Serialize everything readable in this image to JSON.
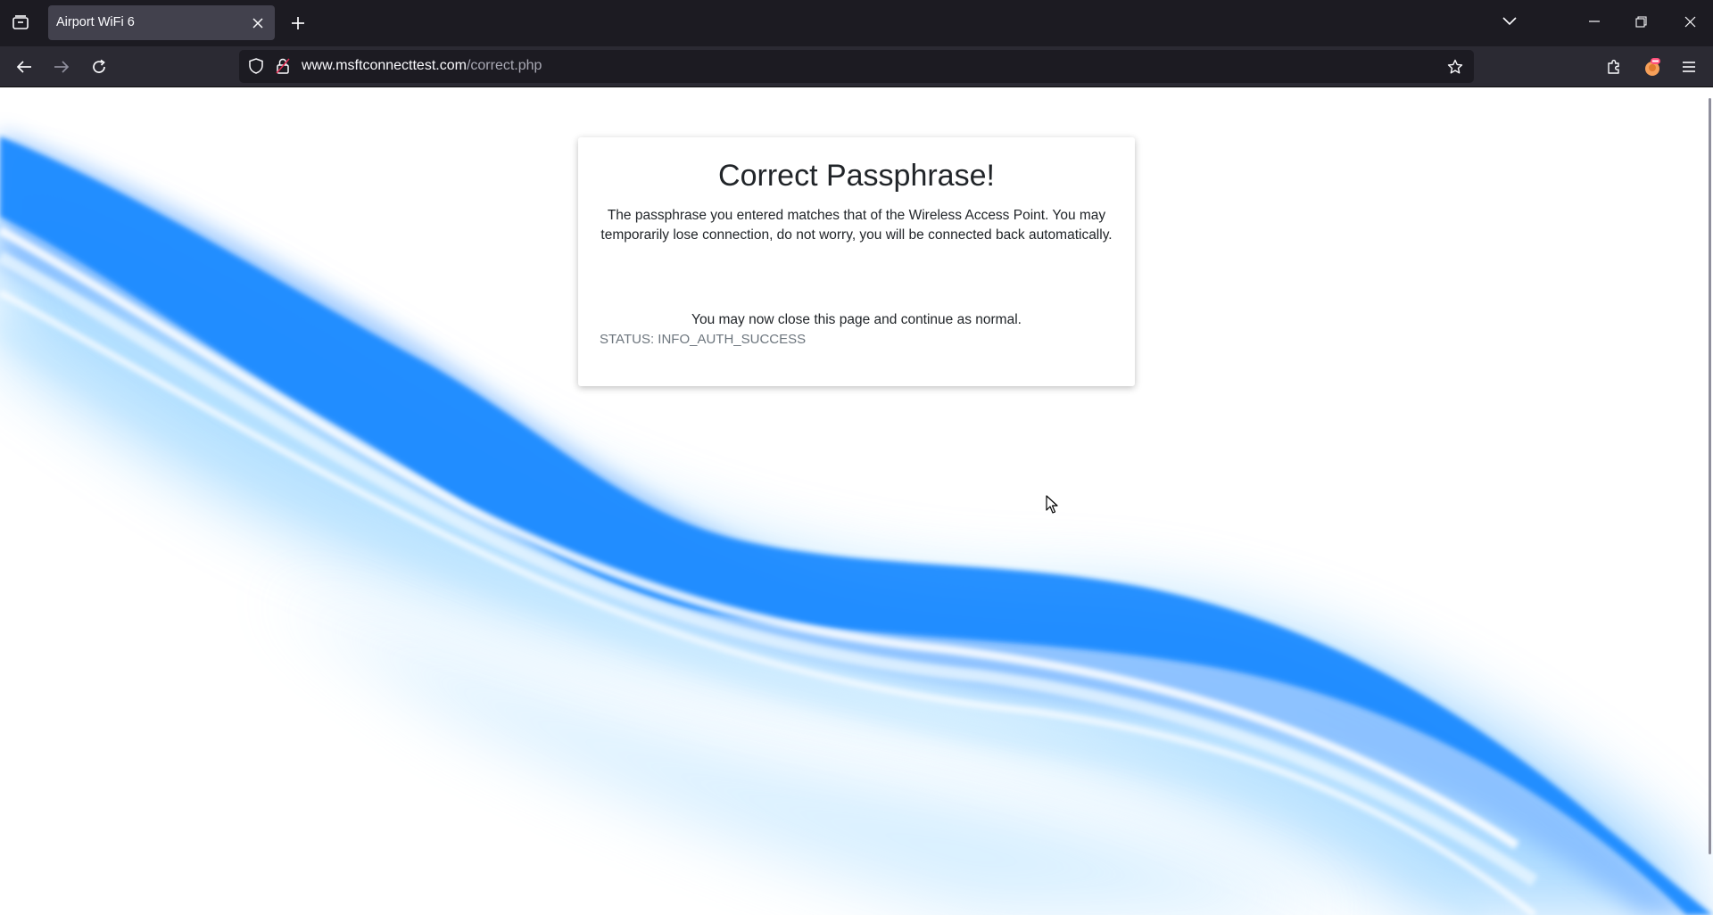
{
  "browser": {
    "tab": {
      "title": "Airport WiFi 6"
    },
    "url": {
      "host": "www.msftconnecttest.com",
      "path": "/correct.php"
    },
    "icons": {
      "tab_list": "tab-list-icon",
      "tab_close": "close-icon",
      "new_tab": "plus-icon",
      "tab_overflow": "chevron-down-icon",
      "minimize": "minimize-icon",
      "restore": "restore-icon",
      "window_close": "close-icon",
      "back": "arrow-left-icon",
      "forward": "arrow-right-icon",
      "reload": "reload-icon",
      "tracking": "shield-icon",
      "connection": "lock-icon",
      "bookmark": "star-icon",
      "extensions": "puzzle-icon",
      "profile": "avatar-icon",
      "menu": "hamburger-icon"
    }
  },
  "page": {
    "title": "Correct Passphrase!",
    "message": "The passphrase you entered matches that of the Wireless Access Point. You may temporarily lose connection, do not worry, you will be connected back automatically.",
    "close_note": "You may now close this page and continue as normal.",
    "status": "STATUS: INFO_AUTH_SUCCESS"
  },
  "colors": {
    "chrome_dark": "#1c1b22",
    "toolbar": "#2b2a33",
    "tab_active": "#42414d",
    "wave_blue": "#1a8cff",
    "wave_light": "#8ec9ff"
  }
}
